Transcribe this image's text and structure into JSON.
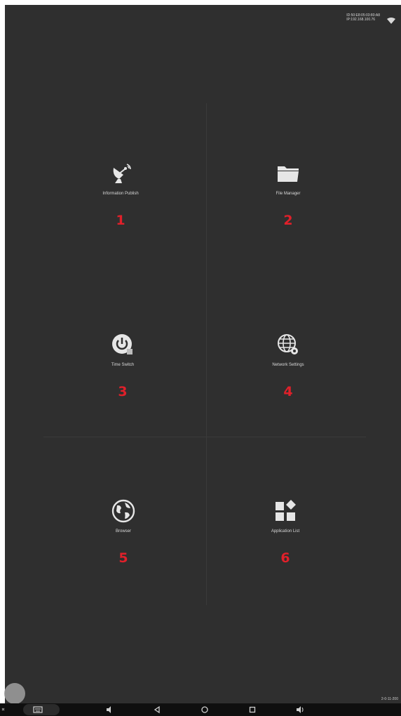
{
  "status": {
    "id_line": "ID:50:E8:05:03:80:A8",
    "ip_line": "IP:192.168.100.76"
  },
  "tiles": [
    {
      "label": "Information Publish",
      "number": "1",
      "icon": "satellite-dish-icon"
    },
    {
      "label": "File Manager",
      "number": "2",
      "icon": "folder-icon"
    },
    {
      "label": "Time Switch",
      "number": "3",
      "icon": "power-timer-icon"
    },
    {
      "label": "Network Settings",
      "number": "4",
      "icon": "globe-gear-icon"
    },
    {
      "label": "Browser",
      "number": "5",
      "icon": "globe-icon"
    },
    {
      "label": "Application List",
      "number": "6",
      "icon": "app-grid-icon"
    }
  ],
  "clock": "2-0-11-200",
  "colors": {
    "background": "#2f2f2f",
    "number": "#e0202a",
    "text": "#d8d8d8"
  }
}
